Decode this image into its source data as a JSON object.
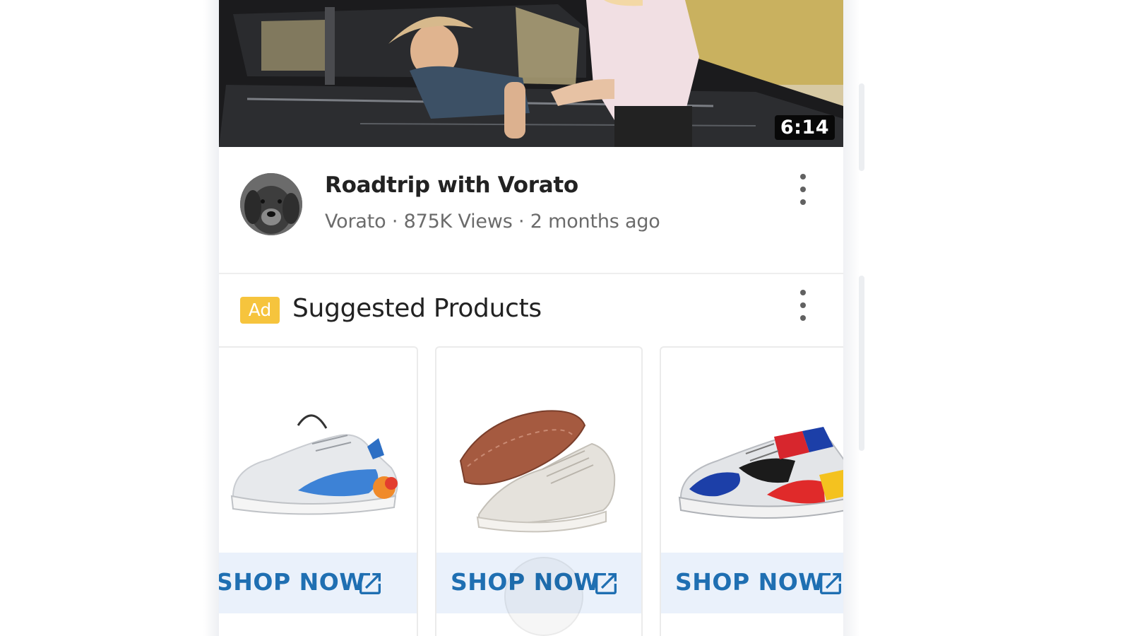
{
  "video": {
    "duration": "6:14",
    "title": "Roadtrip with Vorato",
    "channel": "Vorato",
    "views": "875K Views",
    "age": "2 months ago",
    "separator": "·"
  },
  "ad": {
    "badge": "Ad",
    "title": "Suggested Products",
    "products": [
      {
        "cta": "SHOP NOW",
        "shoe": "white-blue-sneaker"
      },
      {
        "cta": "SHOP NOW",
        "shoe": "white-knit-sneaker"
      },
      {
        "cta": "SHOP NOW",
        "shoe": "multicolor-sneaker"
      }
    ]
  },
  "icons": {
    "menu": "more-vert-icon",
    "cta": "open-in-new-icon"
  },
  "colors": {
    "ad_badge": "#f6c43d",
    "cta_text": "#1f6fb2",
    "cta_background": "#eaf1fb"
  }
}
